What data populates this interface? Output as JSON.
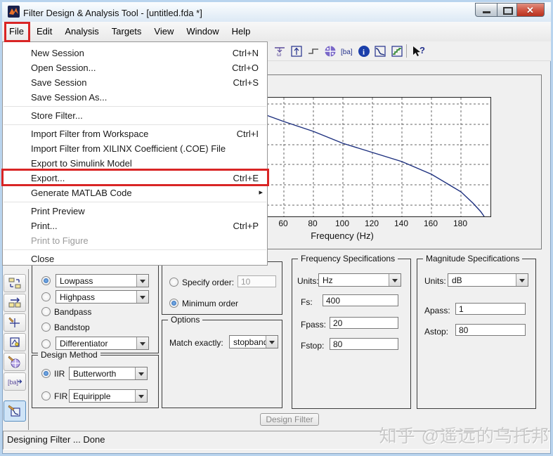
{
  "window": {
    "title": "Filter Design & Analysis Tool -  [untitled.fda *]"
  },
  "menu_bar": {
    "items": [
      "File",
      "Edit",
      "Analysis",
      "Targets",
      "View",
      "Window",
      "Help"
    ]
  },
  "file_menu": {
    "items": [
      {
        "label": "New Session",
        "shortcut": "Ctrl+N"
      },
      {
        "label": "Open Session...",
        "shortcut": "Ctrl+O"
      },
      {
        "label": "Save Session",
        "shortcut": "Ctrl+S"
      },
      {
        "label": "Save Session As...",
        "shortcut": ""
      },
      {
        "label": "Store Filter...",
        "shortcut": ""
      },
      {
        "label": "Import Filter from Workspace",
        "shortcut": "Ctrl+I"
      },
      {
        "label": "Import Filter from XILINX Coefficient (.COE) File",
        "shortcut": ""
      },
      {
        "label": "Export to Simulink Model",
        "shortcut": ""
      },
      {
        "label": "Export...",
        "shortcut": "Ctrl+E"
      },
      {
        "label": "Generate MATLAB Code",
        "shortcut": "",
        "submenu_arrow": "▸"
      },
      {
        "label": "Print Preview",
        "shortcut": ""
      },
      {
        "label": "Print...",
        "shortcut": "Ctrl+P"
      },
      {
        "label": "Print to Figure",
        "shortcut": "",
        "disabled": true
      },
      {
        "label": "Close",
        "shortcut": ""
      }
    ]
  },
  "toolbar": {
    "icons": [
      "filter-specs",
      "impulse-response",
      "step-response",
      "pole-zero-plot",
      "filter-coefficients",
      "filter-info",
      "magnitude-response",
      "round-to-fixed-point",
      "what-is-this-help"
    ],
    "coeff_glyph": "[ba]",
    "info_glyph": "i",
    "help_glyph": "?",
    "omega_glyph": "ω"
  },
  "plot": {
    "xlabel": "Frequency (Hz)",
    "x_ticks": [
      "60",
      "80",
      "100",
      "120",
      "140",
      "160",
      "180"
    ]
  },
  "chart_data": {
    "type": "line",
    "title": "Magnitude response (lowpass Butterworth, partially hidden by open menu)",
    "xlabel": "Frequency (Hz)",
    "x_visible_range": [
      50,
      200
    ],
    "x_ticks": [
      60,
      80,
      100,
      120,
      140,
      160,
      180
    ],
    "grid": "dashed",
    "series": [
      {
        "name": "magnitude-response-curve",
        "x_hz": [
          50,
          60,
          80,
          100,
          120,
          140,
          160,
          180,
          188,
          193,
          196
        ],
        "y_fraction_of_plot_height_from_top": [
          0.13,
          0.2,
          0.28,
          0.38,
          0.46,
          0.54,
          0.64,
          0.79,
          0.89,
          0.96,
          1.0
        ]
      }
    ]
  },
  "response_type": {
    "lowpass": "Lowpass",
    "highpass": "Highpass",
    "bandpass": "Bandpass",
    "bandstop": "Bandstop",
    "differentiator": "Differentiator"
  },
  "design_method": {
    "title": "Design Method",
    "iir_label": "IIR",
    "iir_value": "Butterworth",
    "fir_label": "FIR",
    "fir_value": "Equiripple"
  },
  "filter_order": {
    "specify_label": "Specify order:",
    "specify_value": "10",
    "minimum_label": "Minimum order"
  },
  "options_panel": {
    "title": "Options",
    "match_label": "Match exactly:",
    "match_value": "stopband"
  },
  "freq_specs": {
    "title": "Frequency Specifications",
    "units_label": "Units:",
    "units_value": "Hz",
    "fs_label": "Fs:",
    "fs_value": "400",
    "fpass_label": "Fpass:",
    "fpass_value": "20",
    "fstop_label": "Fstop:",
    "fstop_value": "80"
  },
  "mag_specs": {
    "title": "Magnitude Specifications",
    "units_label": "Units:",
    "units_value": "dB",
    "apass_label": "Apass:",
    "apass_value": "1",
    "astop_label": "Astop:",
    "astop_value": "80"
  },
  "design_button": {
    "label": "Design Filter"
  },
  "status_bar": {
    "text": "Designing Filter ... Done"
  },
  "watermark": {
    "text": "知乎 @遥远的乌托邦"
  },
  "colors": {
    "annotation_red": "#d92525",
    "curve_navy": "#1c2f7e",
    "selected_radio_blue": "#2a66b4",
    "info_blue": "#1b3faa",
    "stair_green": "#1a7a1a",
    "icon_purple": "#7a68c8"
  }
}
